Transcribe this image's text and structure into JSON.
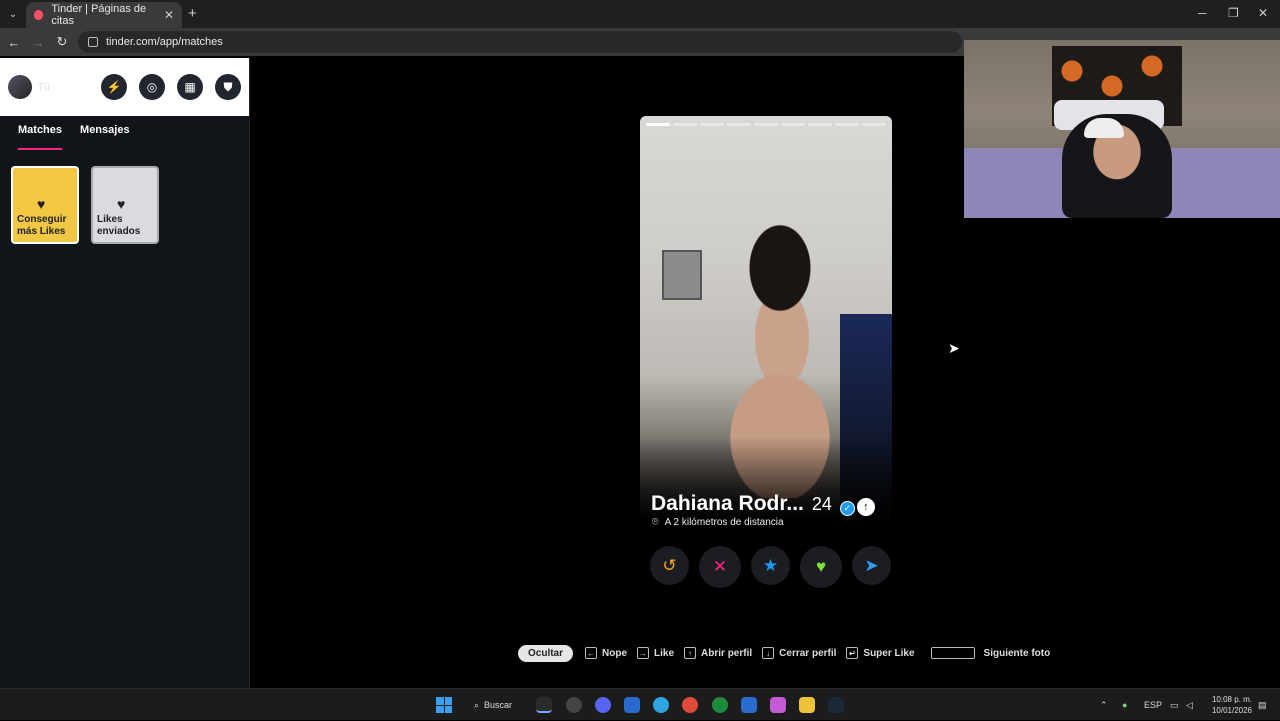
{
  "browser": {
    "tab_title": "Tinder | Páginas de citas",
    "url": "tinder.com/app/matches",
    "new_tab_glyph": "+",
    "close_glyph": "✕"
  },
  "sidebar": {
    "user_label": "Tú",
    "tabs": [
      {
        "label": "Matches",
        "active": true
      },
      {
        "label": "Mensajes",
        "active": false
      }
    ],
    "cards": [
      {
        "label": "Conseguir más Likes"
      },
      {
        "label": "Likes enviados"
      }
    ]
  },
  "profile": {
    "name": "Dahiana Rodr...",
    "age": "24",
    "distance": "A 2 kilómetros de distancia",
    "photo_count": 9,
    "active_photo": 1
  },
  "shortcuts": {
    "hide_label": "Ocultar",
    "items": [
      {
        "key": "←",
        "label": "Nope"
      },
      {
        "key": "→",
        "label": "Like"
      },
      {
        "key": "↑",
        "label": "Abrir perfil"
      },
      {
        "key": "↓",
        "label": "Cerrar perfil"
      },
      {
        "key": "↵",
        "label": "Super Like"
      },
      {
        "key": "",
        "label": "Siguiente foto"
      }
    ]
  },
  "taskbar": {
    "search_label": "Buscar",
    "lang": "ESP",
    "time": "10:08 p. m.",
    "date": "10/01/2026"
  },
  "colors": {
    "brand": "#fd267a",
    "nope": "#fd267a",
    "like": "#7ddf3a",
    "super_like": "#1d9bf0",
    "rewind": "#f5a623"
  }
}
